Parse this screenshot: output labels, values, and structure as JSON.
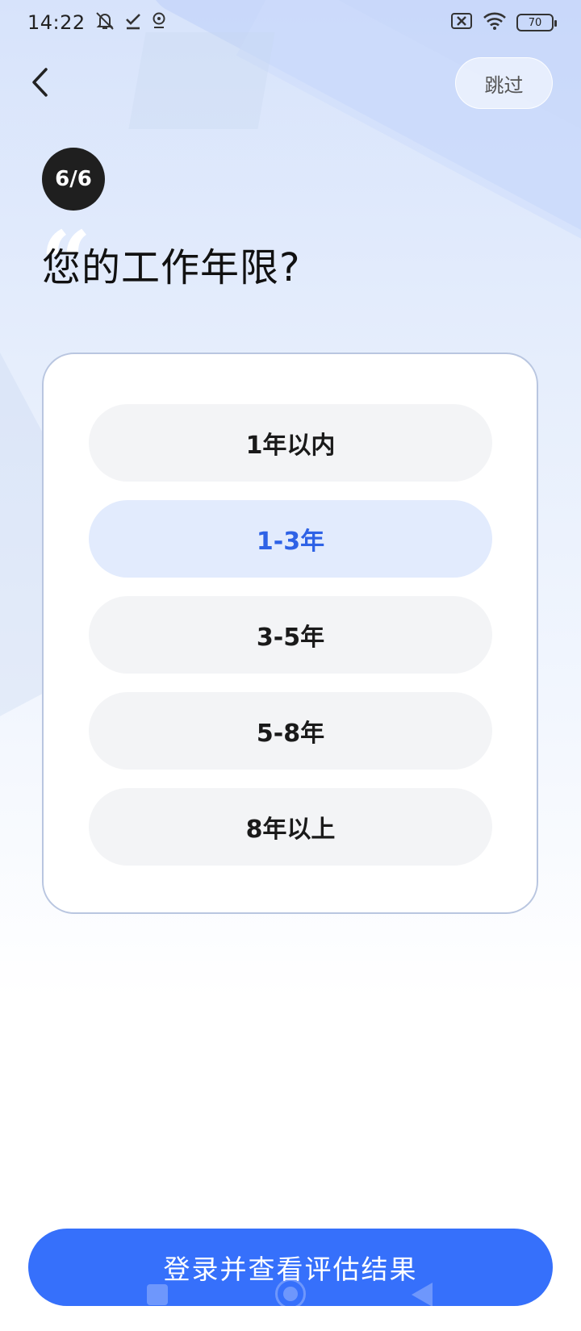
{
  "status_bar": {
    "time": "14:22",
    "battery": "70",
    "left_icons": [
      "mute-bell-icon",
      "check-icon",
      "location-pin-icon"
    ],
    "right_icons": [
      "sim-blocked-icon",
      "wifi-icon",
      "battery-icon"
    ]
  },
  "header": {
    "back_icon": "chevron-left-icon",
    "skip_label": "跳过"
  },
  "progress": {
    "label": "6/6",
    "current": 6,
    "total": 6
  },
  "question": {
    "quote_mark": "“",
    "title": "您的工作年限?"
  },
  "options": [
    {
      "label": "1年以内",
      "selected": false
    },
    {
      "label": "1-3年",
      "selected": true
    },
    {
      "label": "3-5年",
      "selected": false
    },
    {
      "label": "5-8年",
      "selected": false
    },
    {
      "label": "8年以上",
      "selected": false
    }
  ],
  "cta": {
    "label": "登录并查看评估结果"
  },
  "nav_bar": {
    "icons": [
      "recents-square-icon",
      "home-circle-icon",
      "back-triangle-icon"
    ]
  },
  "colors": {
    "primary": "#3670fb",
    "selected_text": "#2e62e6",
    "selected_bg": "#e2ebfd",
    "option_bg": "#f3f4f6",
    "badge_bg": "#1f1f1f"
  }
}
